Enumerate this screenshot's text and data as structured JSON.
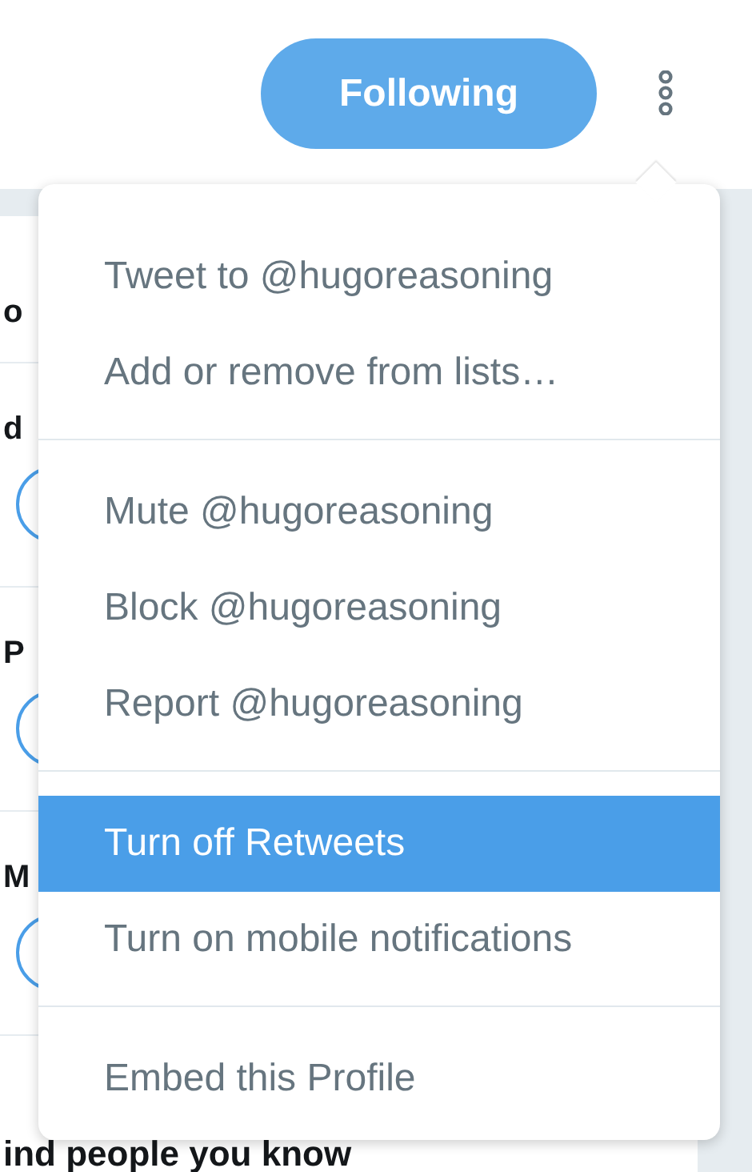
{
  "header": {
    "follow_button": "Following"
  },
  "background": {
    "heading": "o",
    "rows": [
      {
        "name": "d"
      },
      {
        "name": "P"
      },
      {
        "name": "M"
      }
    ],
    "footer": "ind people you know"
  },
  "menu": {
    "sections": [
      [
        {
          "label": "Tweet to @hugoreasoning",
          "selected": false
        },
        {
          "label": "Add or remove from lists…",
          "selected": false
        }
      ],
      [
        {
          "label": "Mute @hugoreasoning",
          "selected": false
        },
        {
          "label": "Block @hugoreasoning",
          "selected": false
        },
        {
          "label": "Report @hugoreasoning",
          "selected": false
        }
      ],
      [
        {
          "label": "Turn off Retweets",
          "selected": true
        },
        {
          "label": "Turn on mobile notifications",
          "selected": false
        }
      ],
      [
        {
          "label": "Embed this Profile",
          "selected": false
        }
      ]
    ]
  }
}
